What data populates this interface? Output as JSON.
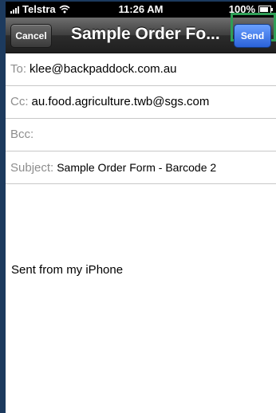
{
  "status_bar": {
    "carrier": "Telstra",
    "time": "11:26 AM",
    "battery": "100%",
    "icons": [
      "signal-bars-icon",
      "wifi-icon",
      "battery-icon"
    ]
  },
  "nav_bar": {
    "cancel_label": "Cancel",
    "title": "Sample Order Fo...",
    "send_label": "Send",
    "colors": {
      "send_button": "#2b62d8",
      "highlight_border": "#2e9e56"
    }
  },
  "compose": {
    "to_label": "To:",
    "to_value": "klee@backpaddock.com.au",
    "cc_label": "Cc:",
    "cc_value": "au.food.agriculture.twb@sgs.com",
    "bcc_label": "Bcc:",
    "bcc_value": "",
    "subject_label": "Subject:",
    "subject_value": "Sample Order Form - Barcode 2",
    "body": "Sent from my iPhone"
  }
}
